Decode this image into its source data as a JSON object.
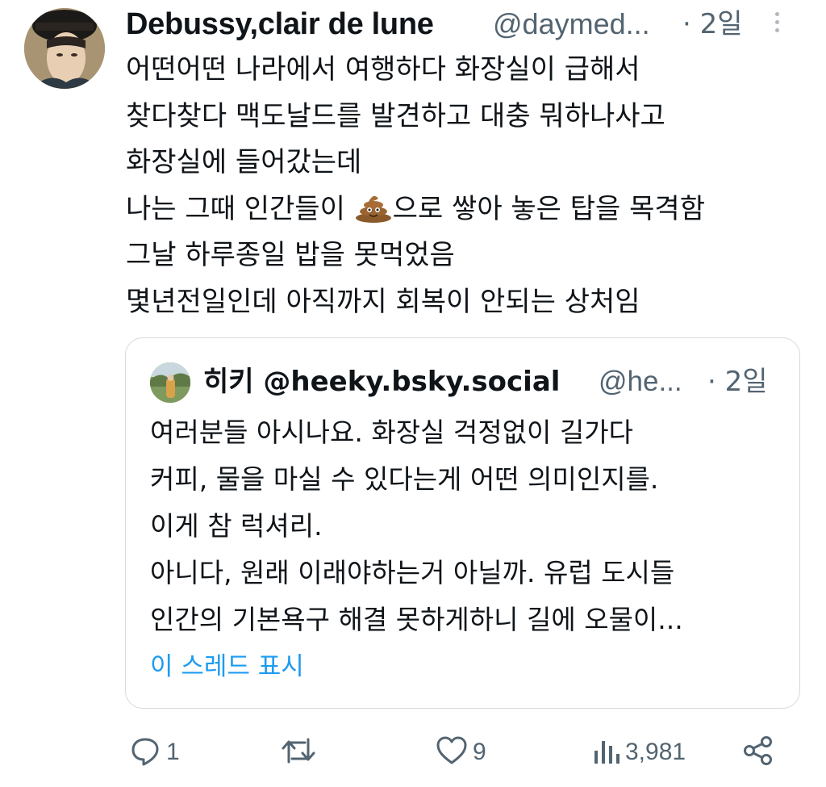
{
  "post": {
    "display_name": "Debussy,clair de lune",
    "handle": "@daymed...",
    "time": "· 2일",
    "lines": [
      "어떤어떤 나라에서 여행하다 화장실이 급해서",
      "찾다찾다 맥도날드를 발견하고 대충 뭐하나사고",
      "화장실에 들어갔는데"
    ],
    "line4_before": "나는 그때 인간들이 ",
    "line4_after": "으로 쌓아 놓은 탑을 목격함",
    "lines_end": [
      "그날 하루종일 밥을 못먹었음",
      "몇년전일인데 아직까지 회복이 안되는 상처임"
    ],
    "emoji": "poop-emoji"
  },
  "quote": {
    "display_name": "히키 @heeky.bsky.social",
    "handle": "@he...",
    "time": "· 2일",
    "lines": [
      "여러분들 아시나요. 화장실 걱정없이 길가다",
      "커피, 물을 마실 수 있다는게 어떤 의미인지를.",
      "이게 참 럭셔리.",
      "아니다, 원래 이래야하는거 아닐까. 유럽 도시들",
      "인간의 기본욕구 해결 못하게하니 길에 오물이..."
    ],
    "show_thread": "이 스레드 표시"
  },
  "actions": {
    "reply_count": "1",
    "repost_count": "",
    "like_count": "9",
    "views_count": "3,981",
    "icons": [
      "reply-icon",
      "repost-icon",
      "like-icon",
      "views-icon",
      "share-icon"
    ]
  },
  "colors": {
    "text": "#0f1419",
    "secondary": "#536471",
    "link": "#1d9bf0",
    "border": "#d4dade"
  }
}
